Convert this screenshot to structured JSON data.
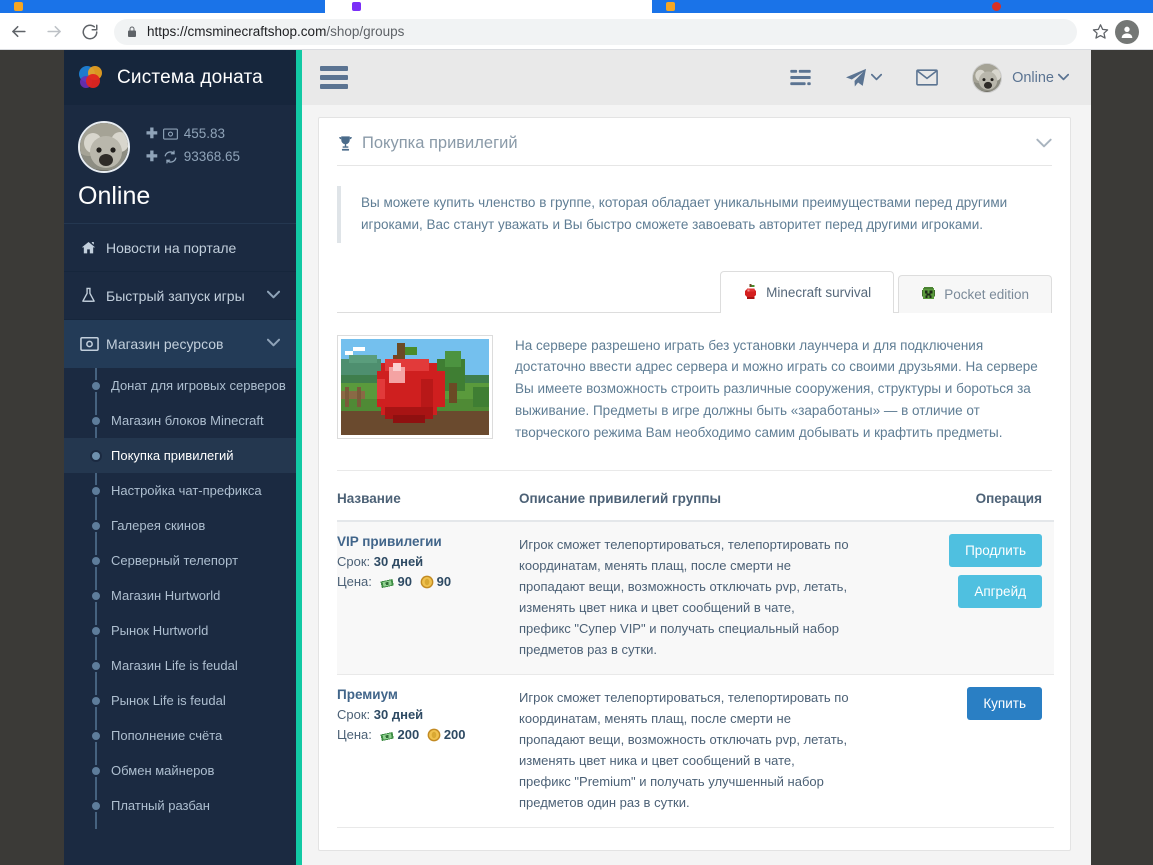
{
  "browser": {
    "url_host": "https://cmsminecraftshop.com",
    "url_path": "/shop/groups",
    "back_icon": "back-arrow-icon",
    "forward_icon": "forward-arrow-icon",
    "reload_icon": "reload-icon",
    "lock_icon": "lock-icon",
    "star_icon": "star-icon",
    "profile_icon": "profile-avatar-icon"
  },
  "sidebar": {
    "brand": "Система доната",
    "logo_icon": "colored-circles-logo",
    "profile": {
      "name": "Online",
      "avatar_icon": "koala-avatar",
      "balance_money": "455.83",
      "balance_coins": "93368.65",
      "money_icon": "banknote-icon",
      "coins_icon": "refresh-coins-icon",
      "plus_icon": "plus-icon"
    },
    "items": [
      {
        "label": "Новости на портале",
        "icon": "home-icon",
        "caret": false
      },
      {
        "label": "Быстрый запуск игры",
        "icon": "flask-icon",
        "caret": true
      },
      {
        "label": "Магазин ресурсов",
        "icon": "banknote-icon",
        "caret": true,
        "open": true
      }
    ],
    "subitems": [
      {
        "label": "Донат для игровых серверов",
        "active": false
      },
      {
        "label": "Магазин блоков Minecraft",
        "active": false
      },
      {
        "label": "Покупка привилегий",
        "active": true
      },
      {
        "label": "Настройка чат-префикса",
        "active": false
      },
      {
        "label": "Галерея скинов",
        "active": false
      },
      {
        "label": "Серверный телепорт",
        "active": false
      },
      {
        "label": "Магазин Hurtworld",
        "active": false
      },
      {
        "label": "Рынок Hurtworld",
        "active": false
      },
      {
        "label": "Магазин Life is feudal",
        "active": false
      },
      {
        "label": "Рынок Life is feudal",
        "active": false
      },
      {
        "label": "Пополнение счёта",
        "active": false
      },
      {
        "label": "Обмен майнеров",
        "active": false
      },
      {
        "label": "Платный разбан",
        "active": false
      }
    ]
  },
  "topbar": {
    "menu_toggle_icon": "hamburger-icon",
    "servers_icon": "server-list-icon",
    "telegram_icon": "telegram-send-icon",
    "mail_icon": "envelope-icon",
    "user_name": "Online",
    "user_avatar_icon": "koala-avatar",
    "caret_icon": "chevron-down-icon"
  },
  "card": {
    "title": "Покупка привилегий",
    "title_icon": "trophy-icon",
    "collapse_icon": "chevron-down-icon",
    "alert": "Вы можете купить членство в группе, которая обладает уникальными преимуществами перед другими игроками, Вас станут уважать и Вы быстро сможете завоевать авторитет перед другими игроками.",
    "tabs": [
      {
        "label": "Minecraft survival",
        "icon": "apple-icon",
        "active": true
      },
      {
        "label": "Pocket edition",
        "icon": "creeper-icon",
        "active": false
      }
    ],
    "server": {
      "thumb_icon": "minecraft-apple-screenshot",
      "description": "На сервере разрешено играть без установки лаунчера и для подключения достаточно ввести адрес сервера и можно играть со своими друзьями. На сервере Вы имеете возможность строить различные сооружения, структуры и бороться за выживание. Предметы в игре должны быть «заработаны» — в отличие от творческого режима Вам необходимо самим добывать и крафтить предметы."
    },
    "table": {
      "headers": [
        "Название",
        "Описание привилегий группы",
        "Операция"
      ],
      "rows": [
        {
          "name": "VIP привилегии",
          "term_label": "Срок:",
          "term_value": "30 дней",
          "price_label": "Цена:",
          "price_money": "90",
          "price_coins": "90",
          "description": "Игрок сможет телепортироваться, телепортировать по координатам, менять плащ, после смерти не пропадают вещи, возможность отключать pvp, летать, изменять цвет ника и цвет сообщений в чате, префикс \"Супер VIP\" и получать специальный набор предметов раз в сутки.",
          "buttons": [
            {
              "label": "Продлить",
              "style": "info"
            },
            {
              "label": "Апгрейд",
              "style": "info"
            }
          ]
        },
        {
          "name": "Премиум",
          "term_label": "Срок:",
          "term_value": "30 дней",
          "price_label": "Цена:",
          "price_money": "200",
          "price_coins": "200",
          "description": "Игрок сможет телепортироваться, телепортировать по координатам, менять плащ, после смерти не пропадают вещи, возможность отключать pvp, летать, изменять цвет ника и цвет сообщений в чате, префикс \"Premium\" и получать улучшенный набор предметов один раз в сутки.",
          "buttons": [
            {
              "label": "Купить",
              "style": "primary"
            }
          ]
        }
      ]
    }
  },
  "colors": {
    "sidebar_bg": "#1b2a41",
    "sidebar_brand_bg": "#16263c",
    "accent_teal": "#12c9a4",
    "btn_info": "#4fc0e0",
    "btn_primary": "#2a7fc4",
    "text_muted": "#5f7d94",
    "chrome_blue": "#1a73e8"
  }
}
